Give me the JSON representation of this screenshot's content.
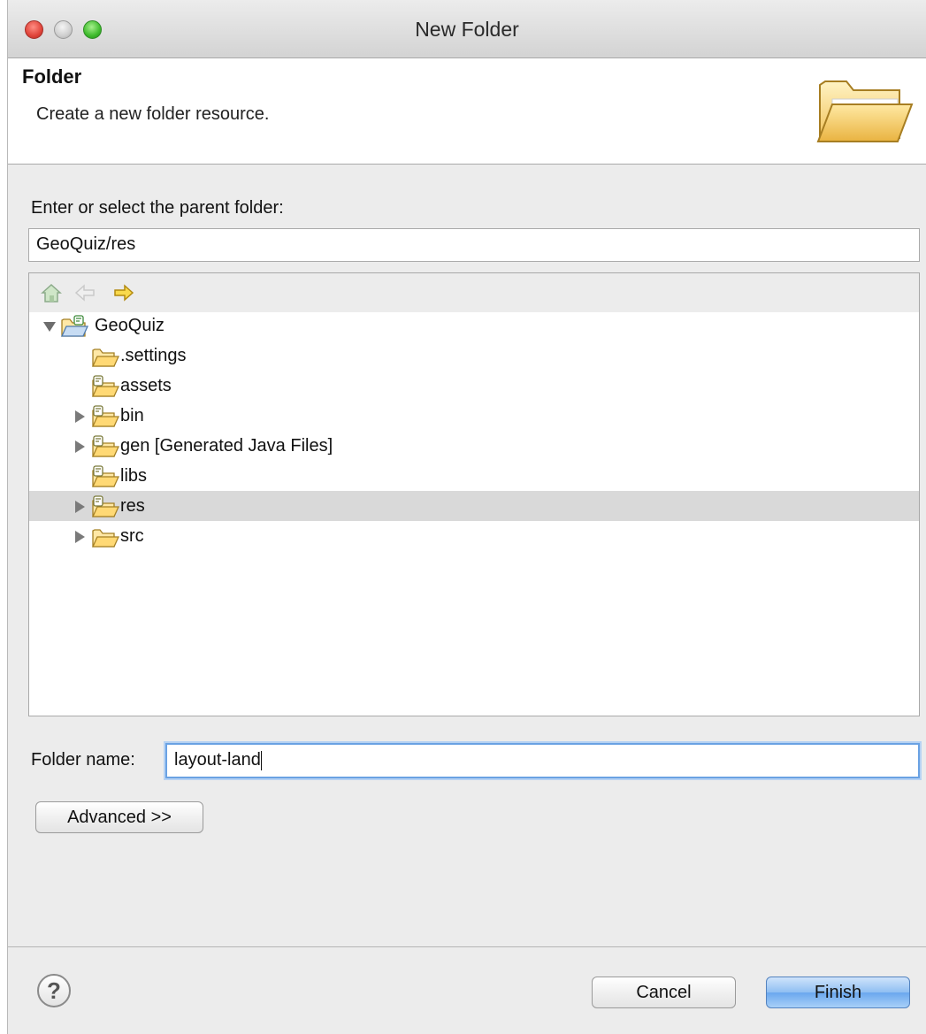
{
  "window": {
    "title": "New Folder"
  },
  "banner": {
    "title": "Folder",
    "description": "Create a new folder resource."
  },
  "parent": {
    "label": "Enter or select the parent folder:",
    "value": "GeoQuiz/res"
  },
  "tree": {
    "toolbar": [
      "home-icon",
      "back-arrow-icon",
      "forward-arrow-icon"
    ],
    "items": [
      {
        "label": "GeoQuiz",
        "level": 0,
        "expanded": true,
        "icon": "project-folder-icon"
      },
      {
        "label": ".settings",
        "level": 1,
        "expanded": null,
        "icon": "folder-icon"
      },
      {
        "label": "assets",
        "level": 1,
        "expanded": null,
        "icon": "source-folder-icon"
      },
      {
        "label": "bin",
        "level": 1,
        "expanded": false,
        "icon": "source-folder-icon"
      },
      {
        "label": "gen [Generated Java Files]",
        "level": 1,
        "expanded": false,
        "icon": "source-folder-icon"
      },
      {
        "label": "libs",
        "level": 1,
        "expanded": null,
        "icon": "source-folder-icon"
      },
      {
        "label": "res",
        "level": 1,
        "expanded": false,
        "icon": "source-folder-icon",
        "selected": true
      },
      {
        "label": "src",
        "level": 1,
        "expanded": false,
        "icon": "folder-icon"
      }
    ]
  },
  "folder_name": {
    "label": "Folder name:",
    "value": "layout-land"
  },
  "advanced_button": "Advanced >>",
  "footer": {
    "help": "?",
    "cancel": "Cancel",
    "finish": "Finish"
  }
}
